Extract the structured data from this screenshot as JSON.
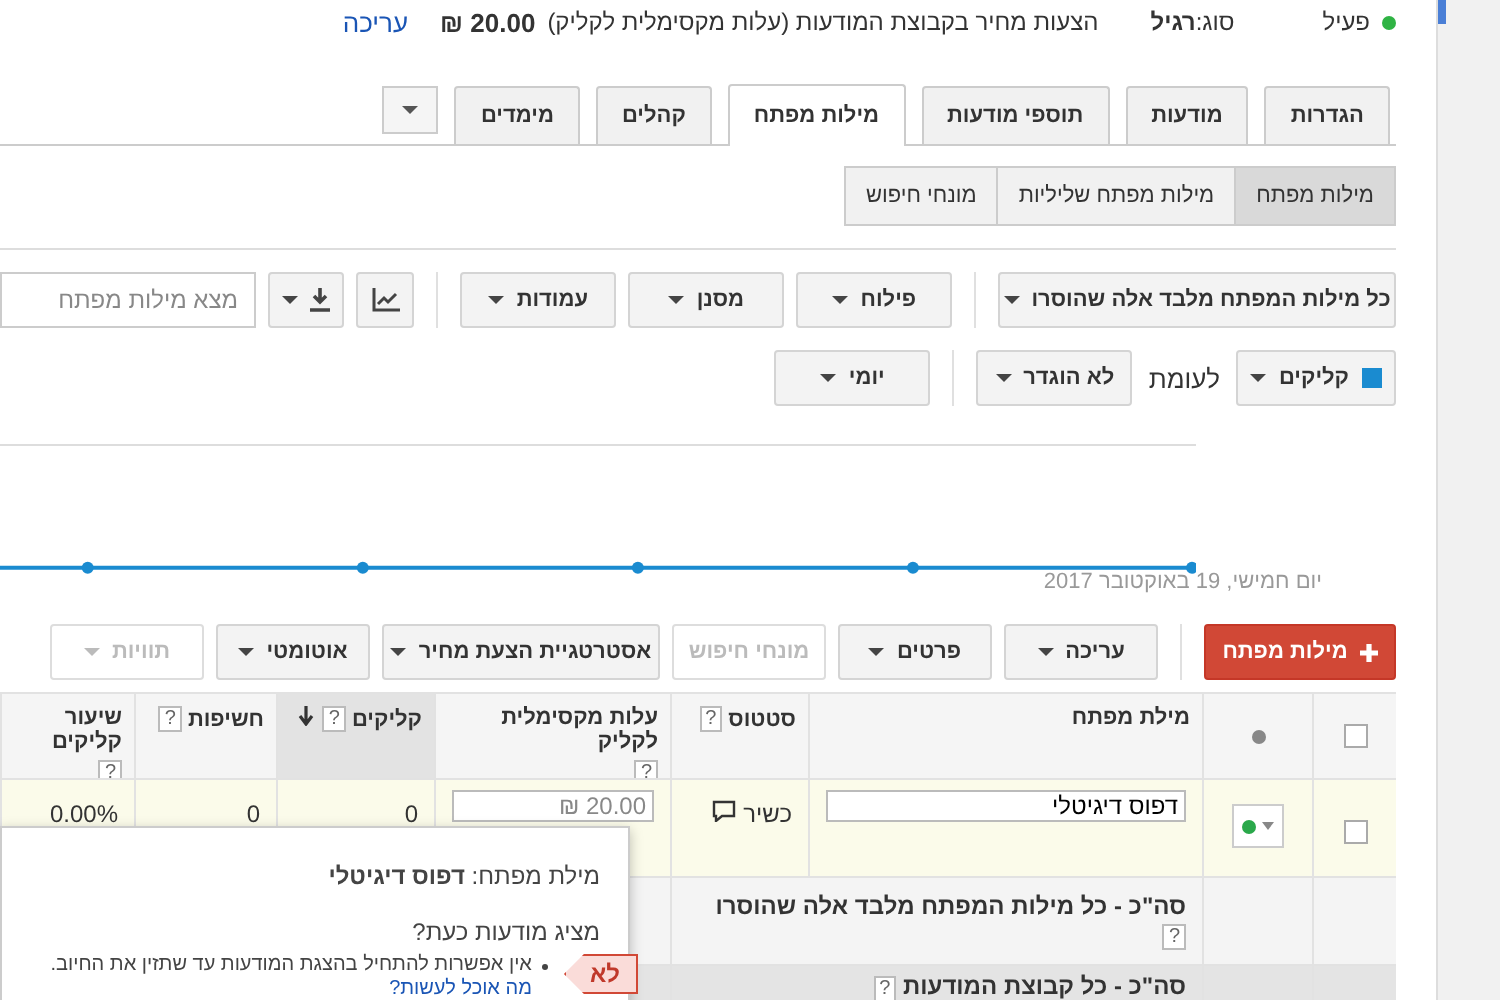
{
  "status_line": {
    "active": true,
    "status": "פעיל",
    "type_label": "סוג:",
    "type_value": "רגיל",
    "bid_label": "הצעות מחיר בקבוצת המודעות (עלות מקסימלית לקליק)",
    "bid_value": "20.00 ₪",
    "edit_link": "עריכה"
  },
  "tabs": [
    {
      "label": "הגדרות",
      "selected": false
    },
    {
      "label": "מודעות",
      "selected": false
    },
    {
      "label": "תוספי מודעות",
      "selected": false
    },
    {
      "label": "מילות מפתח",
      "selected": true
    },
    {
      "label": "קהלים",
      "selected": false
    },
    {
      "label": "מימדים",
      "selected": false
    }
  ],
  "subtabs": [
    {
      "label": "מילות מפתח",
      "selected": true
    },
    {
      "label": "מילות מפתח שליליות",
      "selected": false
    },
    {
      "label": "מונחי חיפוש",
      "selected": false
    }
  ],
  "toolbar": {
    "filters": [
      "כל מילות המפתח מלבד אלה שהוסרו",
      "פילוח",
      "מסנן",
      "עמודות"
    ],
    "search": {
      "placeholder": "מצא מילות מפתח"
    }
  },
  "compare": {
    "metric": {
      "label": "קליקים",
      "color": "#1a8bd0"
    },
    "versus": "לעומת",
    "second_metric": "לא הוגדר",
    "interval": "יומי"
  },
  "chart": {
    "date": "יום חמישי, 19 באוקטובר 2017"
  },
  "actions": [
    {
      "kind": "add",
      "label": "מילות מפתח",
      "disabled": false
    },
    {
      "kind": "dropdown",
      "label": "עריכה",
      "disabled": false
    },
    {
      "kind": "dropdown",
      "label": "פרטים",
      "disabled": false
    },
    {
      "kind": "plain",
      "label": "מונחי חיפוש",
      "disabled": true
    },
    {
      "kind": "dropdown",
      "label": "אסטרטגיית הצעת מחיר",
      "disabled": false
    },
    {
      "kind": "dropdown",
      "label": "אוטומטי",
      "disabled": false
    },
    {
      "kind": "dropdown",
      "label": "תוויות",
      "disabled": true
    }
  ],
  "table": {
    "select_all_checked": false,
    "columns": [
      {
        "label": "מילת מפתח",
        "sorted": false
      },
      {
        "label": "סטטוס",
        "help": "?",
        "sorted": false
      },
      {
        "label": "עלות מקסימלית לקליק",
        "help": "?",
        "sorted": false
      },
      {
        "label": "קליקים",
        "help": "?",
        "sorted": true
      },
      {
        "label": "חשיפות",
        "help": "?",
        "sorted": false
      },
      {
        "label": "שיעור קליקים",
        "help": "?",
        "sorted": false
      }
    ],
    "rows": [
      {
        "checked": false,
        "enabled": true,
        "keyword": "דפוס דיגיטלי",
        "status": "כשיר",
        "max_cpc": "20.00 ₪",
        "clicks": "0",
        "impressions": "0",
        "ctr": "0.00%"
      }
    ],
    "totals": [
      {
        "label": "סה\"כ - כל מילות המפתח מלבד אלה שהוסרו",
        "help": "?"
      },
      {
        "label": "סה\"כ - כל קבוצת המודעות",
        "help": "?"
      }
    ]
  },
  "popup": {
    "keyword_label": "מילת מפתח:",
    "keyword": "דפוס דיגיטלי",
    "question": "מציג מודעות כעת?",
    "answer": "לא",
    "message": "אין אפשרות להתחיל בהצגת המודעות עד שתזין את החיוב.",
    "link": "מה אוכל לעשות?"
  }
}
